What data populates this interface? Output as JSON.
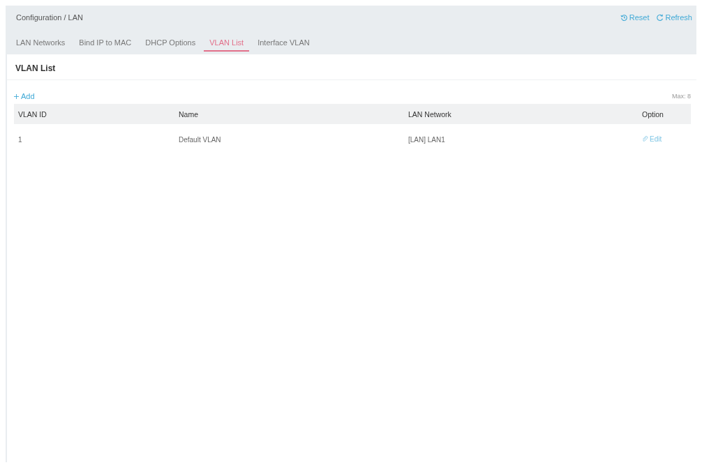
{
  "breadcrumb": "Configuration / LAN",
  "actions": [
    {
      "kind": "reset",
      "label": "Reset"
    },
    {
      "kind": "refresh",
      "label": "Refresh"
    }
  ],
  "tabs": [
    {
      "label": "LAN Networks",
      "selected": false
    },
    {
      "label": "Bind IP to MAC",
      "selected": false
    },
    {
      "label": "DHCP Options",
      "selected": false
    },
    {
      "label": "VLAN List",
      "selected": true
    },
    {
      "label": "Interface VLAN",
      "selected": false
    }
  ],
  "panel": {
    "title": "VLAN List",
    "add_label": "Add",
    "max_label": "Max: 8"
  },
  "table": {
    "columns": [
      "VLAN ID",
      "Name",
      "LAN Network",
      "Option"
    ],
    "rows": [
      {
        "cells": [
          "1",
          "Default VLAN",
          "[LAN] LAN1"
        ],
        "action": "Edit"
      }
    ]
  }
}
